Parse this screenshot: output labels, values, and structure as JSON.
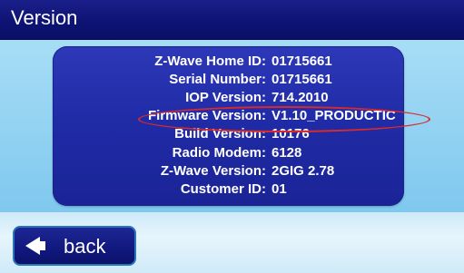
{
  "header": {
    "title": "Version"
  },
  "info": [
    {
      "label": "Z-Wave Home ID:",
      "value": "01715661"
    },
    {
      "label": "Serial Number:",
      "value": "01715661"
    },
    {
      "label": "IOP Version:",
      "value": "714.2010"
    },
    {
      "label": "Firmware Version:",
      "value": "V1.10_PRODUCTIC"
    },
    {
      "label": "Build Version:",
      "value": "10176"
    },
    {
      "label": "Radio Modem:",
      "value": "6128"
    },
    {
      "label": "Z-Wave Version:",
      "value": "2GIG 2.78"
    },
    {
      "label": "Customer ID:",
      "value": "01"
    }
  ],
  "footer": {
    "back_label": "back",
    "back_icon": "left-arrow-icon"
  },
  "colors": {
    "title_bar": "#0d1373",
    "panel": "#1f2aa5",
    "highlight_ellipse": "#d92a2a",
    "background": "#8fd0f0"
  }
}
